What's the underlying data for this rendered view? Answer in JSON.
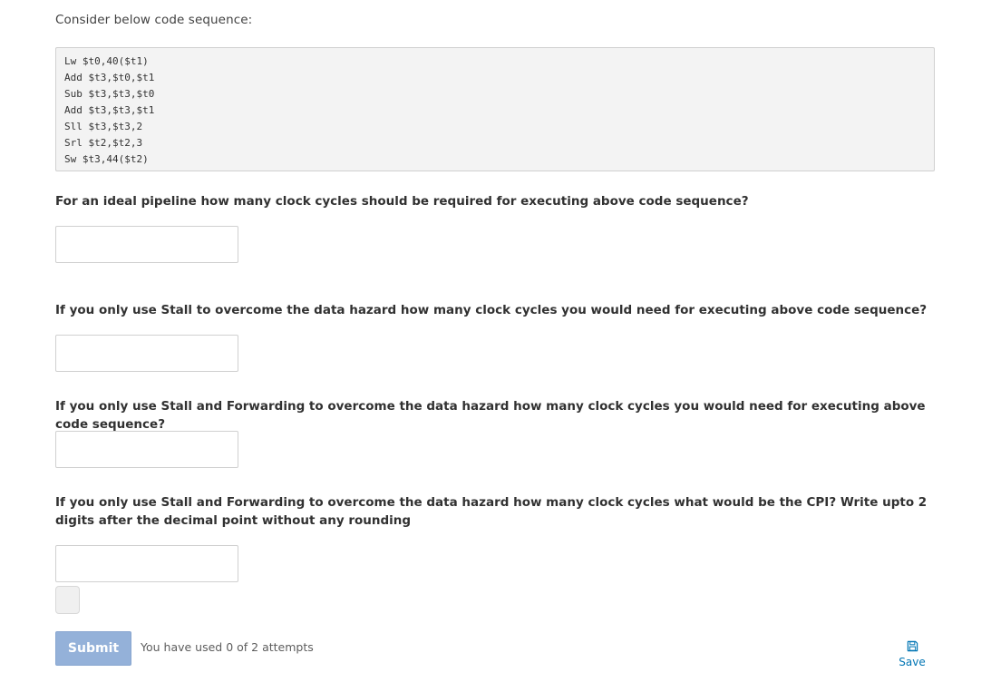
{
  "intro": "Consider below code sequence:",
  "code_lines": [
    "Lw $t0,40($t1)",
    "Add $t3,$t0,$t1",
    "Sub $t3,$t3,$t0",
    "Add $t3,$t3,$t1",
    "Sll $t3,$t3,2",
    "Srl $t2,$t2,3",
    "Sw $t3,44($t2)"
  ],
  "questions": [
    {
      "text": "For an ideal pipeline how many clock cycles should be required for executing above code sequence?",
      "value": "",
      "placeholder": ""
    },
    {
      "text": "If you only use Stall to overcome the data hazard how many clock cycles you would need for executing above code sequence?",
      "value": "",
      "placeholder": ""
    },
    {
      "text": "If you only use Stall and Forwarding to overcome the data hazard how many clock cycles you would need for executing above code sequence?",
      "value": "",
      "placeholder": ""
    },
    {
      "text": "If you only use Stall and Forwarding to overcome the data hazard how many clock cycles what would be the CPI? Write upto 2 digits after the decimal point without any rounding",
      "value": "",
      "placeholder": ""
    }
  ],
  "actions": {
    "submit_label": "Submit",
    "attempts_text": "You have used 0 of 2 attempts",
    "save_label": "Save",
    "save_icon": "floppy-disk-icon"
  },
  "colors": {
    "submit_bg": "#94b1d9",
    "link": "#0075b4",
    "code_bg": "#f3f3f3"
  }
}
